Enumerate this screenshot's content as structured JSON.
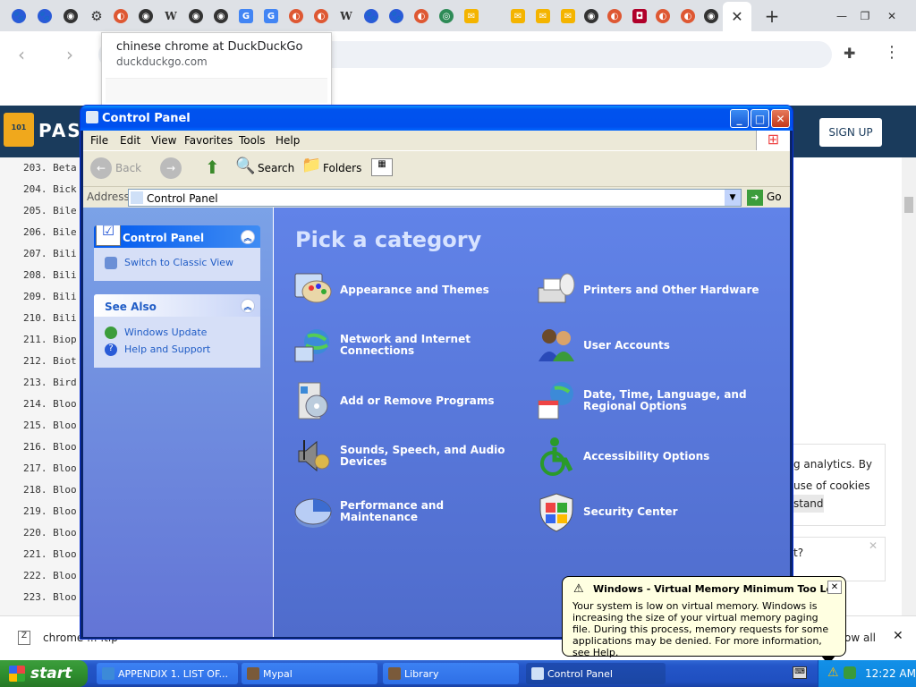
{
  "browser": {
    "preview_title": "chinese chrome at DuckDuckGo",
    "preview_url": "duckduckgo.com",
    "download_item": "chrome ... .tip",
    "download_show_all": "ow all"
  },
  "page": {
    "logo_text": "PAS",
    "signup_label": "SIGN UP",
    "list_rows": [
      "203. Beta",
      "204. Bick",
      "205. Bile",
      "206. Bile",
      "207. Bili",
      "208. Bili",
      "209. Bili",
      "210. Bili",
      "211. Biop",
      "212. Biot",
      "213. Bird",
      "214. Bloo",
      "215. Bloo",
      "216. Bloo",
      "217. Bloo",
      "218. Bloo",
      "219. Bloo",
      "220. Bloo",
      "221. Bloo",
      "222. Bloo",
      "223. Bloo"
    ],
    "card1_lines": [
      "g analytics. By",
      "use of cookies as"
    ],
    "card1_button": "stand",
    "card2_lines": [
      "t?"
    ]
  },
  "window": {
    "title": "Control Panel",
    "menu": [
      "File",
      "Edit",
      "View",
      "Favorites",
      "Tools",
      "Help"
    ],
    "toolbar": {
      "back": "Back",
      "search": "Search",
      "folders": "Folders"
    },
    "address_label": "Address",
    "address_value": "Control Panel",
    "go_label": "Go",
    "left_panel": {
      "title": "Control Panel",
      "switch_link": "Switch to Classic View",
      "see_also_title": "See Also",
      "see_also": [
        "Windows Update",
        "Help and Support"
      ]
    },
    "heading": "Pick a category",
    "categories_left": [
      "Appearance and Themes",
      "Network and Internet Connections",
      "Add or Remove Programs",
      "Sounds, Speech, and Audio Devices",
      "Performance and Maintenance"
    ],
    "categories_right": [
      "Printers and Other Hardware",
      "User Accounts",
      "Date, Time, Language, and Regional Options",
      "Accessibility Options",
      "Security Center"
    ]
  },
  "balloon": {
    "title": "Windows - Virtual Memory Minimum Too Low",
    "text": "Your system is low on virtual memory. Windows is increasing the size of your virtual memory paging file. During this process, memory requests for some applications may be denied. For more information, see Help."
  },
  "taskbar": {
    "start_label": "start",
    "tasks": [
      "APPENDIX 1. LIST OF...",
      "Mypal",
      "Library",
      "Control Panel"
    ],
    "clock": "12:22 AM"
  }
}
